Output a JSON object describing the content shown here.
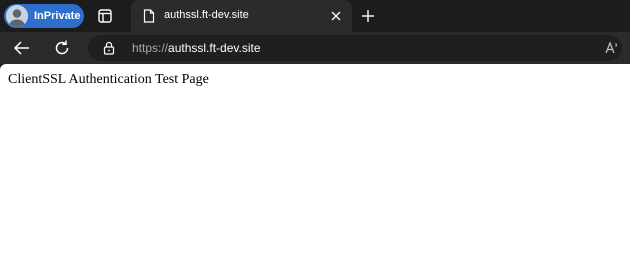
{
  "browser": {
    "inprivate_label": "InPrivate",
    "tab": {
      "title": "authssl.ft-dev.site",
      "favicon": "document-icon"
    },
    "address": {
      "scheme": "https://",
      "host": "authssl.ft-dev.site"
    }
  },
  "page": {
    "text": "ClientSSL Authentication Test Page"
  },
  "colors": {
    "inprivate_accent": "#2f6fcc",
    "tabstrip_bg": "#1c1c1c",
    "toolbar_bg": "#2b2b2b",
    "addressbar_bg": "#1f1f1f",
    "page_bg": "#ffffff"
  }
}
